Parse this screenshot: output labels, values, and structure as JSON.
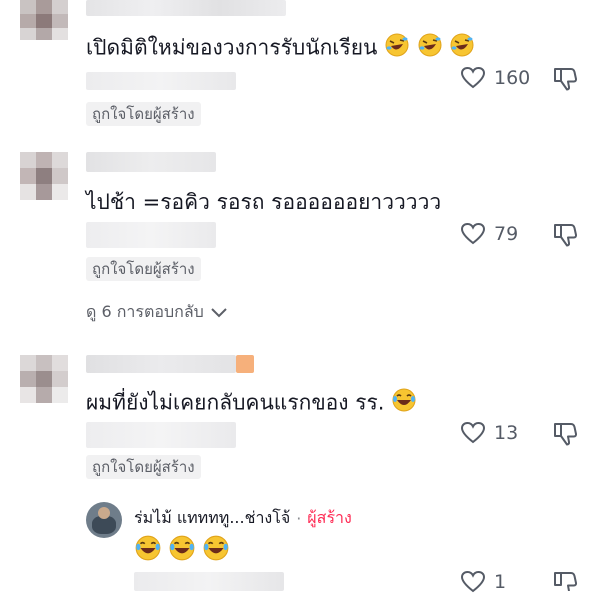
{
  "comments": [
    {
      "text": "เปิดมิติใหม่ของวงการรับนักเรียน",
      "emoji_count": 3,
      "emoji_icon": "rofl-emoji",
      "like_count": "160",
      "badge": "ถูกใจโดยผู้สร้าง"
    },
    {
      "text": "ไปช้า =รอคิว รอรถ รออออออยาววววว",
      "like_count": "79",
      "badge": "ถูกใจโดยผู้สร้าง",
      "view_replies": "ดู 6 การตอบกลับ"
    },
    {
      "text": "ผมที่ยังไม่เคยกลับคนแรกของ รร.",
      "emoji_icon": "joy-emoji",
      "like_count": "13",
      "badge": "ถูกใจโดยผู้สร้าง"
    }
  ],
  "reply": {
    "author": "ร่มไม้ แททททู...ช่างโจ้",
    "separator": "·",
    "creator_label": "ผู้สร้าง",
    "emoji_count": 3,
    "emoji_icon": "joy-emoji",
    "like_count": "1"
  },
  "colors": {
    "accent": "#fe2c55",
    "muted": "#5c5f67",
    "badge_bg": "#f1f1f2"
  }
}
